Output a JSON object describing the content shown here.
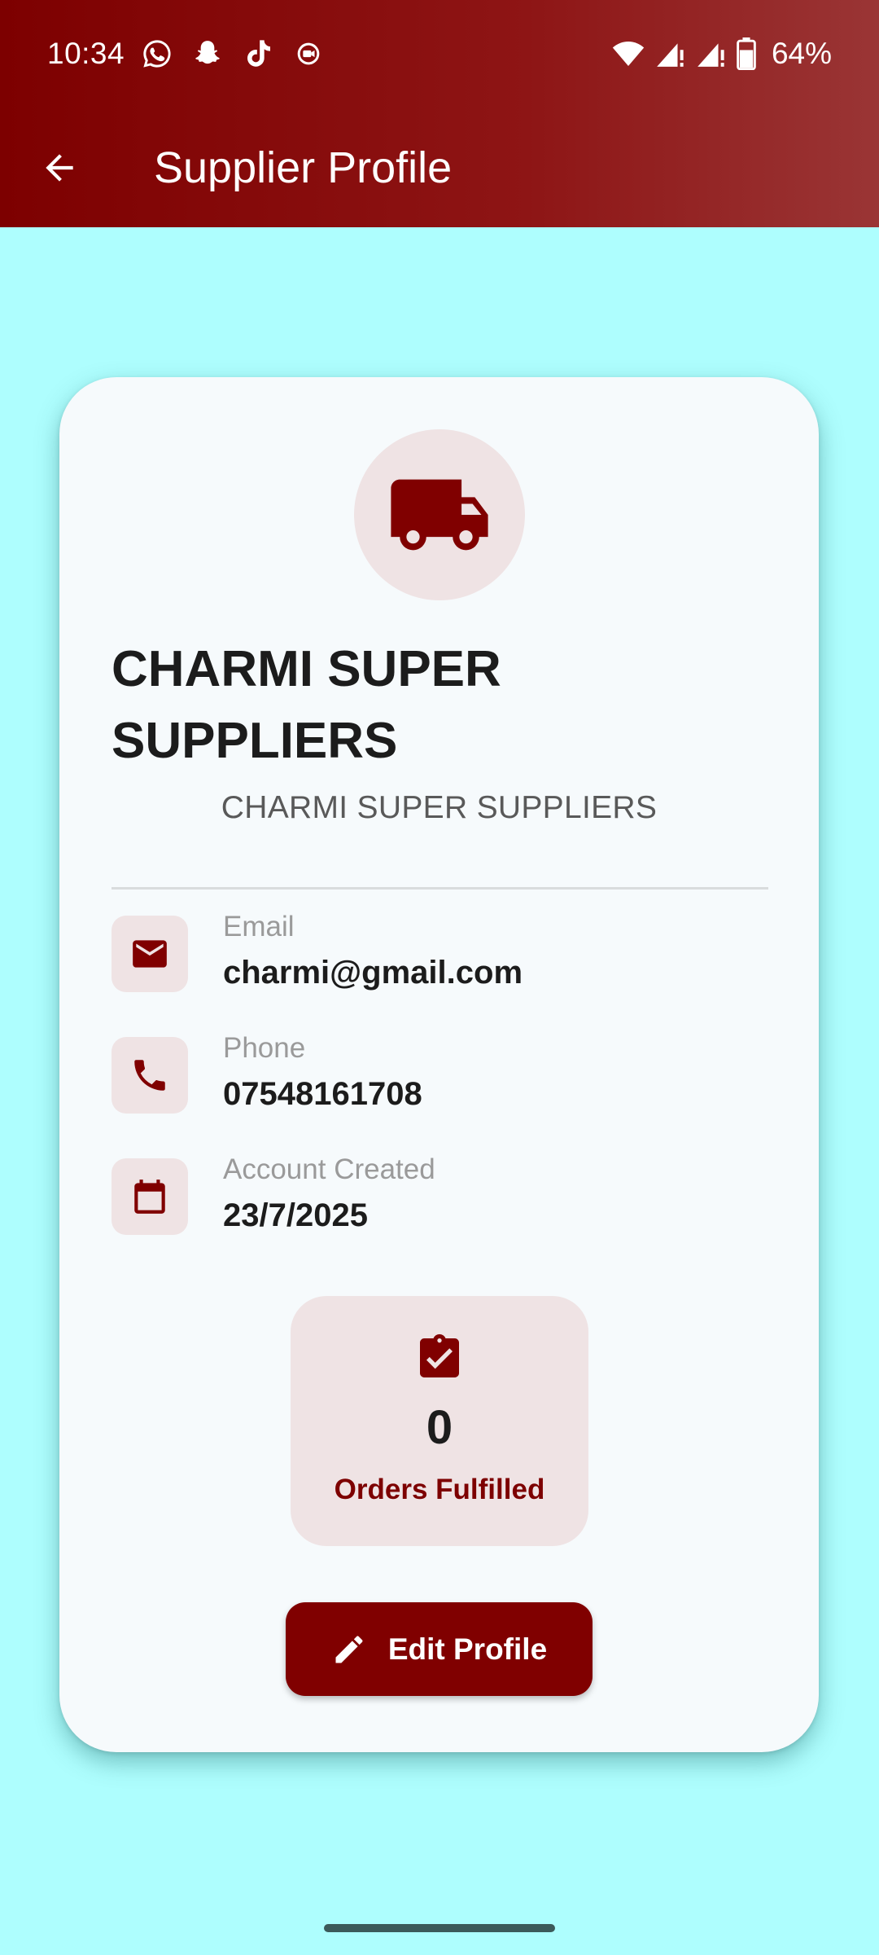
{
  "status_bar": {
    "time": "10:34",
    "battery": "64%",
    "notification_icons": [
      "whatsapp-icon",
      "snapchat-icon",
      "tiktok-icon",
      "screen-record-icon"
    ],
    "system_icons": [
      "wifi-icon",
      "signal-icon",
      "signal-icon",
      "battery-icon"
    ]
  },
  "toolbar": {
    "title": "Supplier Profile",
    "back_icon": "arrow-back-icon"
  },
  "profile": {
    "avatar_icon": "truck-icon",
    "company_name": "CHARMI SUPER SUPPLIERS",
    "company_subtitle": "CHARMI SUPER SUPPLIERS"
  },
  "details": [
    {
      "icon": "email-icon",
      "label": "Email",
      "value": "charmi@gmail.com"
    },
    {
      "icon": "phone-icon",
      "label": "Phone",
      "value": "07548161708"
    },
    {
      "icon": "calendar-icon",
      "label": "Account Created",
      "value": "23/7/2025"
    }
  ],
  "stats": {
    "icon": "clipboard-check-icon",
    "orders_fulfilled_value": "0",
    "orders_fulfilled_label": "Orders Fulfilled"
  },
  "actions": {
    "edit_label": "Edit Profile",
    "edit_icon": "pencil-icon"
  },
  "colors": {
    "primary": "#800000",
    "background": "#aefefe",
    "card": "#f6fafc",
    "icon_bg": "#efe3e4"
  }
}
